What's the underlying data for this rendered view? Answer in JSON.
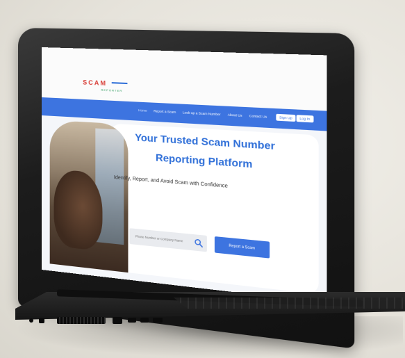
{
  "logo": {
    "main": "SCAM",
    "sub": "REPORTER"
  },
  "nav": {
    "links": [
      "Home",
      "Report a Scam",
      "Look up a Scam Number",
      "About Us",
      "Contact Us"
    ],
    "signup": "Sign Up",
    "login": "Log In"
  },
  "hero": {
    "title_line1": "Your Trusted Scam Number",
    "title_line2": "Reporting Platform",
    "subtitle": "Identify, Report, and Avoid Scam with Confidence",
    "search_placeholder": "Phone Number or Company Name",
    "report_button": "Report a Scam"
  },
  "colors": {
    "brand_blue": "#3d74e0",
    "logo_red": "#d9413a",
    "logo_green": "#2a9a5a"
  }
}
